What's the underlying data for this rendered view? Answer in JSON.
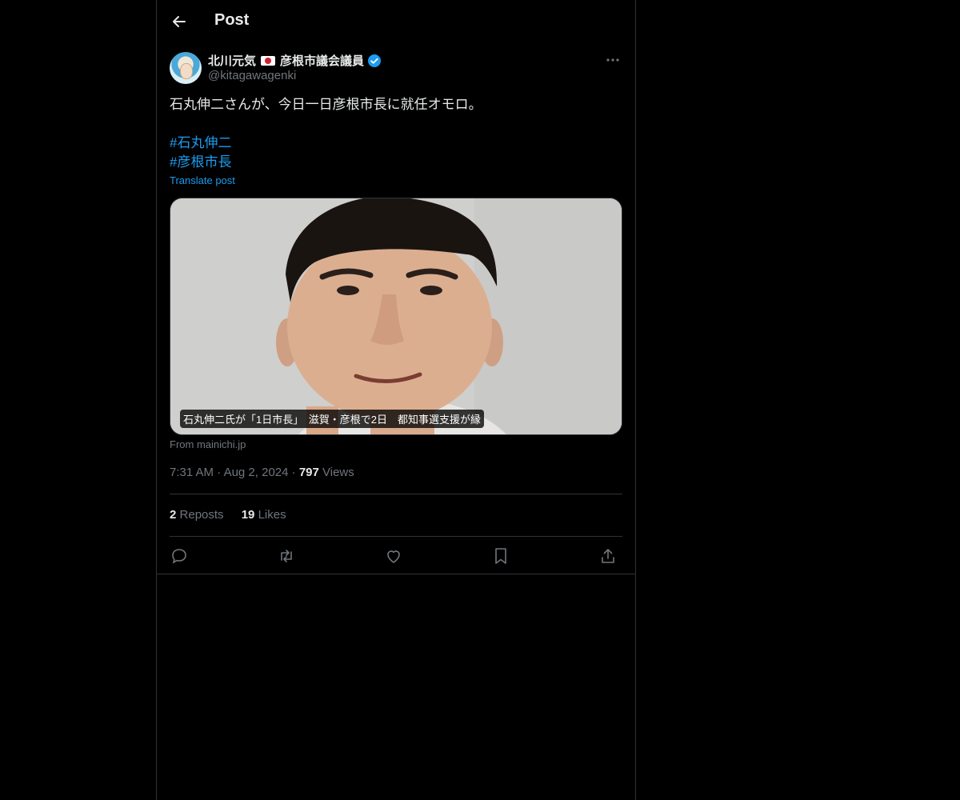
{
  "header": {
    "title": "Post"
  },
  "author": {
    "display_name": "北川元気",
    "display_suffix": "彦根市議会議員",
    "handle": "@kitagawagenki"
  },
  "post": {
    "text": "石丸伸二さんが、今日一日彦根市長に就任オモロ。",
    "hashtags": [
      "#石丸伸二",
      "#彦根市長"
    ],
    "translate_label": "Translate post"
  },
  "card": {
    "caption": "石丸伸二氏が「1日市長」　滋賀・彦根で2日　都知事選支援が縁",
    "source": "From mainichi.jp"
  },
  "meta": {
    "time": "7:31 AM",
    "date": "Aug 2, 2024",
    "views_count": "797",
    "views_label": "Views"
  },
  "stats": {
    "reposts_count": "2",
    "reposts_label": "Reposts",
    "likes_count": "19",
    "likes_label": "Likes"
  },
  "colors": {
    "accent": "#1d9bf0",
    "muted": "#71767b",
    "border": "#2f3336",
    "background": "#000000"
  }
}
